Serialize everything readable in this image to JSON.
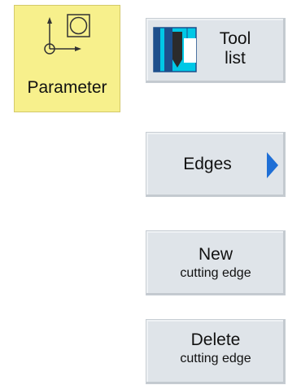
{
  "parameter_tile": {
    "label": "Parameter",
    "icon": "coordinate-frame-icon"
  },
  "softkeys": {
    "tool_list": {
      "line1": "Tool",
      "line2": "list",
      "icon": "tool-holder-icon"
    },
    "edges": {
      "label": "Edges",
      "icon": "triangle-right-icon"
    },
    "new_cutting_edge": {
      "line1": "New",
      "line2": "cutting edge"
    },
    "delete_cutting_edge": {
      "line1": "Delete",
      "line2": "cutting edge"
    }
  },
  "colors": {
    "parameter_background": "#f7f08c",
    "softkey_background": "#dfe4e9",
    "arrow_accent": "#1f6fd6",
    "tool_icon_accent": "#00c8e6"
  }
}
